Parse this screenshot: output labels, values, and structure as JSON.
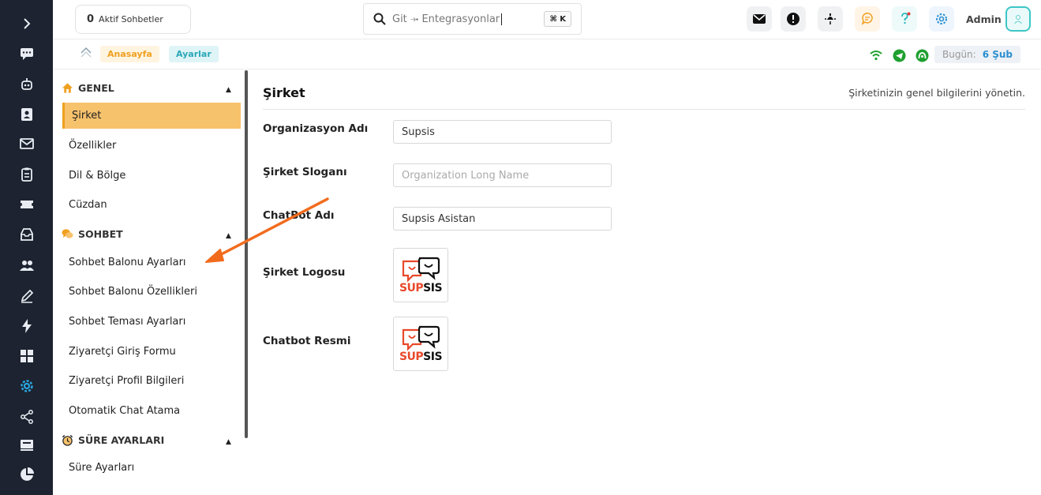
{
  "topbar": {
    "active_chats_count": "0",
    "active_chats_label": "Aktif Sohbetler",
    "search_placeholder": "Git ⤞ Entegrasyonlar",
    "search_shortcut": "⌘ K",
    "user_label": "Admin"
  },
  "breadcrumb": {
    "home": "Anasayfa",
    "current": "Ayarlar",
    "today_label": "Bugün:",
    "today_value": "6 Şub"
  },
  "colors": {
    "rail_bg": "#1d2330",
    "accent_orange": "#f0a020",
    "active_item_bg": "#f7c26c",
    "accent_teal": "#2aa8b8",
    "arrow": "#f26b1d"
  },
  "sidebar": {
    "sections": [
      {
        "title": "GENEL",
        "icon": "home-icon",
        "items": [
          "Şirket",
          "Özellikler",
          "Dil & Bölge",
          "Cüzdan"
        ]
      },
      {
        "title": "SOHBET",
        "icon": "chat-bubbles-icon",
        "items": [
          "Sohbet Balonu Ayarları",
          "Sohbet Balonu Özellikleri",
          "Sohbet Teması Ayarları",
          "Ziyaretçi Giriş Formu",
          "Ziyaretçi Profil Bilgileri",
          "Otomatik Chat Atama"
        ]
      },
      {
        "title": "SÜRE AYARLARI",
        "icon": "alarm-clock-icon",
        "items": [
          "Süre Ayarları"
        ]
      }
    ],
    "active_item": "Şirket"
  },
  "main": {
    "title": "Şirket",
    "description": "Şirketinizin genel bilgilerini yönetin.",
    "fields": {
      "org_name_label": "Organizasyon Adı",
      "org_name_value": "Supsis",
      "slogan_label": "Şirket Sloganı",
      "slogan_placeholder": "Organization Long Name",
      "chatbot_name_label": "ChatBot Adı",
      "chatbot_name_value": "Supsis Asistan",
      "logo_label": "Şirket Logosu",
      "chatbot_image_label": "Chatbot Resmi"
    },
    "logo": {
      "part1": "SUP",
      "part2": "SIS"
    }
  }
}
